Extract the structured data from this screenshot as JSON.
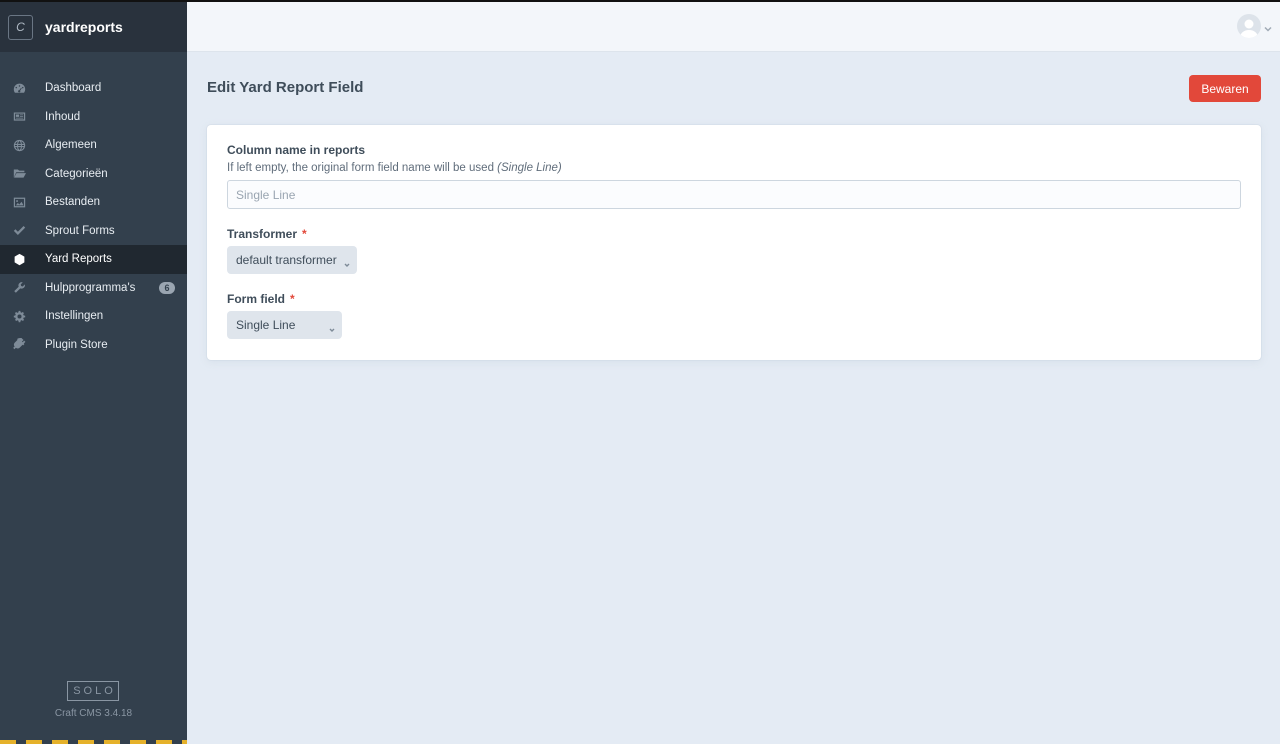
{
  "site": {
    "logo_letter": "C",
    "name": "yardreports"
  },
  "nav": {
    "items": [
      {
        "label": "Dashboard",
        "icon": "gauge-icon"
      },
      {
        "label": "Inhoud",
        "icon": "newspaper-icon"
      },
      {
        "label": "Algemeen",
        "icon": "globe-icon"
      },
      {
        "label": "Categorieën",
        "icon": "folder-icon"
      },
      {
        "label": "Bestanden",
        "icon": "image-icon"
      },
      {
        "label": "Sprout Forms",
        "icon": "check-icon"
      },
      {
        "label": "Yard Reports",
        "icon": "hexagon-icon",
        "active": true
      },
      {
        "label": "Hulpprogramma's",
        "icon": "wrench-icon",
        "badge": "6"
      },
      {
        "label": "Instellingen",
        "icon": "cog-icon"
      },
      {
        "label": "Plugin Store",
        "icon": "plug-icon"
      }
    ]
  },
  "footer": {
    "edition": "SOLO",
    "version": "Craft CMS 3.4.18"
  },
  "header": {
    "account_icon": "user-avatar-icon"
  },
  "page": {
    "title": "Edit Yard Report Field",
    "save_label": "Bewaren"
  },
  "form": {
    "column_name": {
      "label": "Column name in reports",
      "instructions": "If left empty, the original form field name will be used ",
      "instructions_em": "(Single Line)",
      "placeholder": "Single Line",
      "value": ""
    },
    "transformer": {
      "label": "Transformer",
      "required_mark": "*",
      "selected": "default transformer"
    },
    "form_field": {
      "label": "Form field",
      "required_mark": "*",
      "selected": "Single Line"
    }
  },
  "colors": {
    "sidebar": "#33404d",
    "sidebar_header": "#29323d",
    "accent_red": "#e2483a",
    "page_bg": "#e4ebf4"
  }
}
